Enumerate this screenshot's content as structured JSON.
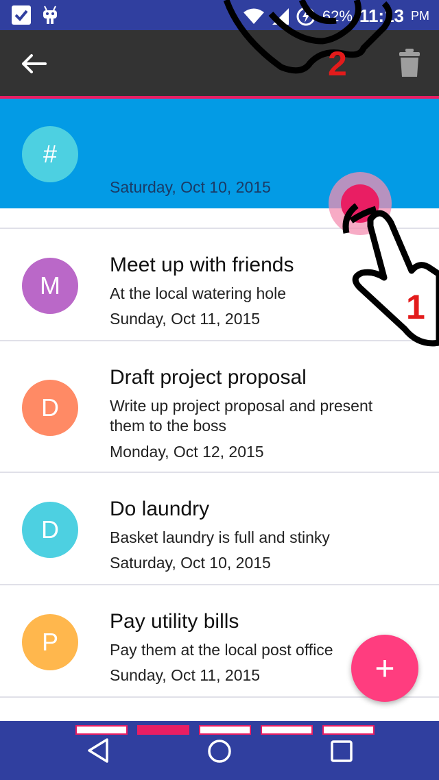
{
  "status_bar": {
    "battery": "62%",
    "time": "11:13",
    "ampm": "PM",
    "icons": [
      "check-box-icon",
      "android-icon",
      "wifi-icon",
      "signal-icon",
      "battery-charging-icon"
    ]
  },
  "app_bar": {
    "back_icon": "back-arrow-icon",
    "delete_icon": "trash-icon"
  },
  "selected_item": {
    "avatar": "#",
    "date": "Saturday, Oct 10, 2015",
    "color": "#4dd0e1"
  },
  "items": [
    {
      "avatar": "M",
      "color": "#ba68c8",
      "title": "Meet up with friends",
      "desc": "At the local watering hole",
      "date": "Sunday, Oct 11, 2015"
    },
    {
      "avatar": "D",
      "color": "#ff8a65",
      "title": "Draft project proposal",
      "desc": "Write up project proposal and present them to the boss",
      "date": "Monday, Oct 12, 2015"
    },
    {
      "avatar": "D",
      "color": "#4dd0e1",
      "title": "Do laundry",
      "desc": "Basket laundry is full and stinky",
      "date": "Saturday, Oct 10, 2015"
    },
    {
      "avatar": "P",
      "color": "#ffb74d",
      "title": "Pay utility bills",
      "desc": "Pay them at the local post office",
      "date": "Sunday, Oct 11, 2015"
    }
  ],
  "fab": {
    "label": "+"
  },
  "gesture_hints": {
    "step1": "1",
    "step2": "2"
  },
  "page_indicator": {
    "count": 5,
    "active": 2
  }
}
